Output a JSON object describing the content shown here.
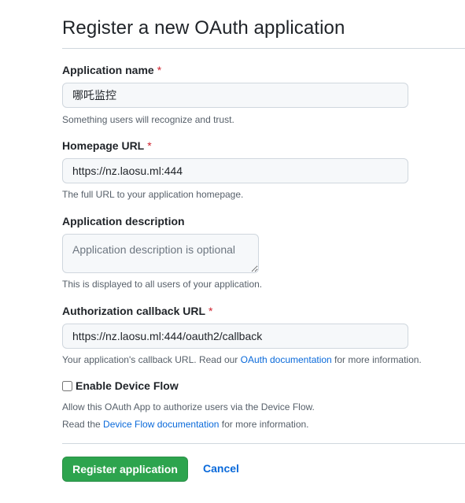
{
  "page": {
    "title": "Register a new OAuth application"
  },
  "form": {
    "app_name": {
      "label": "Application name",
      "required_mark": "*",
      "value": "哪吒监控",
      "note": "Something users will recognize and trust."
    },
    "homepage": {
      "label": "Homepage URL",
      "required_mark": "*",
      "value": "https://nz.laosu.ml:444",
      "note": "The full URL to your application homepage."
    },
    "description": {
      "label": "Application description",
      "placeholder": "Application description is optional",
      "note": "This is displayed to all users of your application."
    },
    "callback": {
      "label": "Authorization callback URL",
      "required_mark": "*",
      "value": "https://nz.laosu.ml:444/oauth2/callback",
      "note_before": "Your application's callback URL. Read our ",
      "note_link": "OAuth documentation",
      "note_after": " for more information."
    },
    "device_flow": {
      "label": "Enable Device Flow",
      "checked": false,
      "note1": "Allow this OAuth App to authorize users via the Device Flow.",
      "note2_before": "Read the ",
      "note2_link": "Device Flow documentation",
      "note2_after": " for more information."
    }
  },
  "actions": {
    "submit_label": "Register application",
    "cancel_label": "Cancel"
  },
  "colors": {
    "primary_button": "#2da44e",
    "link": "#0969da",
    "required": "#cf222e"
  }
}
